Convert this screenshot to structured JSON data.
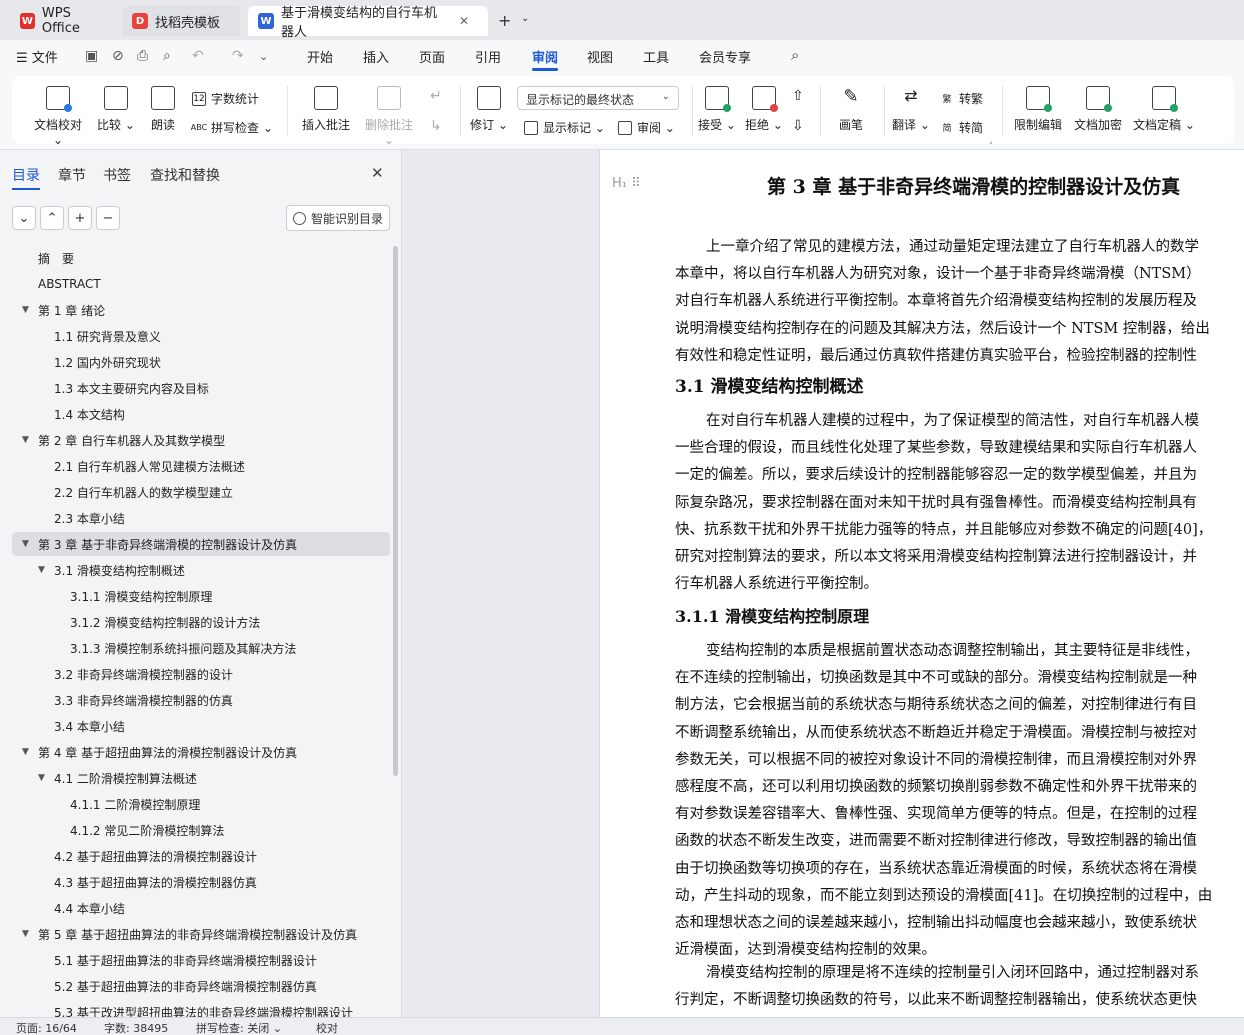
{
  "tabs": [
    {
      "label": "WPS Office",
      "icon": "wps-logo-icon"
    },
    {
      "label": "找稻壳模板",
      "icon": "docer-icon"
    },
    {
      "label": "基于滑模变结构的自行车机器人",
      "icon": "word-doc-icon"
    }
  ],
  "menubar": {
    "file": "文件",
    "items": [
      "开始",
      "插入",
      "页面",
      "引用",
      "审阅",
      "视图",
      "工具",
      "会员专享"
    ],
    "active": "审阅"
  },
  "ribbon": {
    "doc_check": "文档校对",
    "compare": "比较",
    "read_aloud": "朗读",
    "word_count": "字数统计",
    "spell_check": "拼写检查",
    "insert_comment": "插入批注",
    "delete_comment": "删除批注",
    "revise": "修订",
    "markup_state": "显示标记的最终状态",
    "show_markup": "显示标记",
    "review": "审阅",
    "accept": "接受",
    "reject": "拒绝",
    "pen": "画笔",
    "translate": "翻译",
    "to_traditional": "转繁",
    "to_simplified": "转简",
    "restrict_edit": "限制编辑",
    "encrypt": "文档加密",
    "finalize": "文档定稿"
  },
  "leftpanel": {
    "tabs": [
      "目录",
      "章节",
      "书签",
      "查找和替换"
    ],
    "smart_toc": "智能识别目录",
    "toc": [
      {
        "text": "摘　要",
        "level": 0,
        "arrow": false
      },
      {
        "text": "ABSTRACT",
        "level": 0,
        "arrow": false
      },
      {
        "text": "第 1 章  绪论",
        "level": 0,
        "arrow": true
      },
      {
        "text": "1.1  研究背景及意义",
        "level": 1,
        "arrow": false
      },
      {
        "text": "1.2  国内外研究现状",
        "level": 1,
        "arrow": false
      },
      {
        "text": "1.3  本文主要研究内容及目标",
        "level": 1,
        "arrow": false
      },
      {
        "text": "1.4  本文结构",
        "level": 1,
        "arrow": false
      },
      {
        "text": "第 2 章  自行车机器人及其数学模型",
        "level": 0,
        "arrow": true
      },
      {
        "text": "2.1  自行车机器人常见建模方法概述",
        "level": 1,
        "arrow": false
      },
      {
        "text": "2.2  自行车机器人的数学模型建立",
        "level": 1,
        "arrow": false
      },
      {
        "text": "2.3  本章小结",
        "level": 1,
        "arrow": false
      },
      {
        "text": "第 3 章  基于非奇异终端滑模的控制器设计及仿真",
        "level": 0,
        "arrow": true,
        "selected": true
      },
      {
        "text": "3.1  滑模变结构控制概述",
        "level": 1,
        "arrow": true
      },
      {
        "text": "3.1.1 滑模变结构控制原理",
        "level": 2,
        "arrow": false
      },
      {
        "text": "3.1.2  滑模变结构控制器的设计方法",
        "level": 2,
        "arrow": false
      },
      {
        "text": "3.1.3 滑模控制系统抖振问题及其解决方法",
        "level": 2,
        "arrow": false
      },
      {
        "text": "3.2  非奇异终端滑模控制器的设计",
        "level": 1,
        "arrow": false
      },
      {
        "text": "3.3  非奇异终端滑模控制器的仿真",
        "level": 1,
        "arrow": false
      },
      {
        "text": "3.4  本章小结",
        "level": 1,
        "arrow": false
      },
      {
        "text": "第 4 章  基于超扭曲算法的滑模控制器设计及仿真",
        "level": 0,
        "arrow": true
      },
      {
        "text": "4.1  二阶滑模控制算法概述",
        "level": 1,
        "arrow": true
      },
      {
        "text": "4.1.1  二阶滑模控制原理",
        "level": 2,
        "arrow": false
      },
      {
        "text": "4.1.2  常见二阶滑模控制算法",
        "level": 2,
        "arrow": false
      },
      {
        "text": "4.2  基于超扭曲算法的滑模控制器设计",
        "level": 1,
        "arrow": false
      },
      {
        "text": "4.3  基于超扭曲算法的滑模控制器仿真",
        "level": 1,
        "arrow": false
      },
      {
        "text": "4.4  本章小结",
        "level": 1,
        "arrow": false
      },
      {
        "text": "第 5 章  基于超扭曲算法的非奇异终端滑模控制器设计及仿真",
        "level": 0,
        "arrow": true
      },
      {
        "text": "5.1  基于超扭曲算法的非奇异终端滑模控制器设计",
        "level": 1,
        "arrow": false
      },
      {
        "text": "5.2  基于超扭曲算法的非奇异终端滑模控制器仿真",
        "level": 1,
        "arrow": false
      },
      {
        "text": "5.3  基于改进型超扭曲算法的非奇异终端滑模控制器设计",
        "level": 1,
        "arrow": false
      }
    ]
  },
  "document": {
    "chapter_title": "第 3 章  基于非奇异终端滑模的控制器设计及仿真",
    "section_31": "3.1  滑模变结构控制概述",
    "section_311": "3.1.1 滑模变结构控制原理",
    "para1": [
      "上一章介绍了常见的建模方法，通过动量矩定理法建立了自行车机器人的数学",
      "本章中，将以自行车机器人为研究对象，设计一个基于非奇异终端滑模（NTSM）",
      "对自行车机器人系统进行平衡控制。本章将首先介绍滑模变结构控制的发展历程及",
      "说明滑模变结构控制存在的问题及其解决方法，然后设计一个 NTSM 控制器，给出",
      "有效性和稳定性证明，最后通过仿真软件搭建仿真实验平台，检验控制器的控制性"
    ],
    "para2": [
      "在对自行车机器人建模的过程中，为了保证模型的简洁性，对自行车机器人模",
      "一些合理的假设，而且线性化处理了某些参数，导致建模结果和实际自行车机器人",
      "一定的偏差。所以，要求后续设计的控制器能够容忍一定的数学模型偏差，并且为",
      "际复杂路况，要求控制器在面对未知干扰时具有强鲁棒性。而滑模变结构控制具有",
      "快、抗系数干扰和外界干扰能力强等的特点，并且能够应对参数不确定的问题[40]，",
      "研究对控制算法的要求，所以本文将采用滑模变结构控制算法进行控制器设计，并",
      "行车机器人系统进行平衡控制。"
    ],
    "para3": [
      "变结构控制的本质是根据前置状态动态调整控制输出，其主要特征是非线性，",
      "在不连续的控制输出，切换函数是其中不可或缺的部分。滑模变结构控制就是一种",
      "制方法，它会根据当前的系统状态与期待系统状态之间的偏差，对控制律进行有目",
      "不断调整系统输出，从而使系统状态不断趋近并稳定于滑模面。滑模控制与被控对",
      "参数无关，可以根据不同的被控对象设计不同的滑模控制律，而且滑模控制对外界",
      "感程度不高，还可以利用切换函数的频繁切换削弱参数不确定性和外界干扰带来的",
      "有对参数误差容错率大、鲁棒性强、实现简单方便等的特点。但是，在控制的过程",
      "函数的状态不断发生改变，进而需要不断对控制律进行修改，导致控制器的输出值",
      "由于切换函数等切换项的存在，当系统状态靠近滑模面的时候，系统状态将在滑模",
      "动，产生抖动的现象，而不能立刻到达预设的滑模面[41]。在切换控制的过程中，由",
      "态和理想状态之间的误差越来越小，控制输出抖动幅度也会越来越小，致使系统状",
      "近滑模面，达到滑模变结构控制的效果。"
    ],
    "para4": [
      "滑模变结构控制的原理是将不连续的控制量引入闭环回路中，通过控制器对系",
      "行判定，不断调整切换函数的符号，以此来不断调整控制器输出，使系统状态更快"
    ]
  },
  "statusbar": {
    "page": "页面: 16/64",
    "words": "字数: 38495",
    "spell": "拼写检查: 关闭",
    "proof": "校对"
  }
}
